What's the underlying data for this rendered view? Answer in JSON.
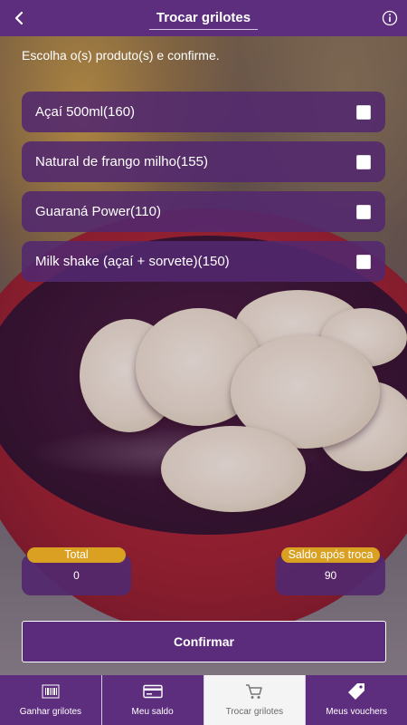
{
  "header": {
    "title": "Trocar grilotes",
    "back_icon": "chevron-left-icon",
    "info_icon": "info-icon"
  },
  "instruction": "Escolha o(s) produto(s) e confirme.",
  "products": [
    {
      "label": "Açaí 500ml(160)",
      "checked": false
    },
    {
      "label": "Natural de frango milho(155)",
      "checked": false
    },
    {
      "label": "Guaraná Power(110)",
      "checked": false
    },
    {
      "label": "Milk shake (açaí + sorvete)(150)",
      "checked": false
    }
  ],
  "summary": {
    "total_label": "Total",
    "total_value": "0",
    "after_label": "Saldo após troca",
    "after_value": "90"
  },
  "confirm_label": "Confirmar",
  "bottom_nav": [
    {
      "label": "Ganhar grilotes",
      "icon": "barcode-icon",
      "active": false
    },
    {
      "label": "Meu saldo",
      "icon": "card-icon",
      "active": false
    },
    {
      "label": "Trocar grilotes",
      "icon": "cart-icon",
      "active": true
    },
    {
      "label": "Meus vouchers",
      "icon": "tag-icon",
      "active": false
    }
  ],
  "colors": {
    "header": "#5e2e7e",
    "panel": "#52286e",
    "pill": "#d9a021",
    "active_tab": "#f4f4f4"
  }
}
